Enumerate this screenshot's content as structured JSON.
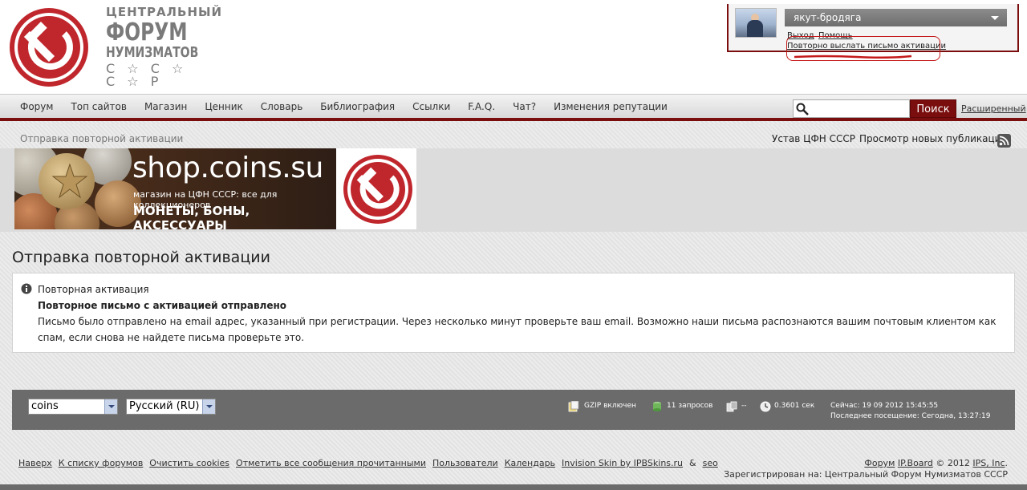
{
  "logo": {
    "line1": "ЦЕНТРАЛЬНЫЙ",
    "line2": "ФОРУМ",
    "line3": "НУМИЗМАТОВ",
    "line4": "С ☆ С ☆ С ☆ Р"
  },
  "user": {
    "name": "якут-бродяга",
    "logout": "Выход",
    "help": "Помощь",
    "resend_activation": "Повторно выслать письмо активации"
  },
  "nav": {
    "items": [
      "Форум",
      "Топ сайтов",
      "Магазин",
      "Ценник",
      "Словарь",
      "Библиография",
      "Ссылки",
      "F.A.Q.",
      "Чат?",
      "Изменения репутации"
    ],
    "search_value": "",
    "search_button": "Поиск",
    "advanced": "Расширенный"
  },
  "breadcrumb": {
    "current": "Отправка повторной активации",
    "charter": "Устав ЦФН СССР",
    "new_posts": "Просмотр новых публикаций"
  },
  "banner": {
    "title": "shop.coins.su",
    "subtitle": "магазин на ЦФН СССР: все для коллекционеров",
    "products": "МОНЕТЫ, БОНЫ, АКСЕССУАРЫ"
  },
  "main": {
    "title": "Отправка повторной активации",
    "message": {
      "heading": "Повторная активация",
      "title": "Повторное письмо с активацией отправлено",
      "body": "Письмо было отправлено на email адрес, указанный при регистрации. Через несколько минут проверьте ваш email. Возможно наши письма распознаются вашим почтовым клиентом как спам, если снова не найдете письма проверьте это."
    }
  },
  "stats": {
    "skin": "coins",
    "language": "Русский (RU)",
    "gzip": "GZIP включен",
    "queries": "11 запросов",
    "dash": "--",
    "time": "0.3601 сек",
    "now": "Сейчас: 19 09 2012 15:45:55",
    "last_visit": "Последнее посещение: Сегодна, 13:27:19"
  },
  "footer": {
    "links": [
      "Наверх",
      "К списку форумов",
      "Очистить cookies",
      "Отметить все сообщения прочитанными",
      "Пользователи",
      "Календарь",
      "Invision Skin by IPBSkins.ru"
    ],
    "amp": "&",
    "seo": "seo",
    "powered_forum": "Форум",
    "powered_ipboard": "IP.Board",
    "powered_copy": "© 2012",
    "powered_ips": "IPS, Inc",
    "registered": "Зарегистрирован на: Центральный Форум Нумизматов СССР"
  },
  "colors": {
    "brand_red": "#7a0e0e",
    "emblem_red": "#c0272d",
    "stats_bar": "#6b6b6b"
  }
}
